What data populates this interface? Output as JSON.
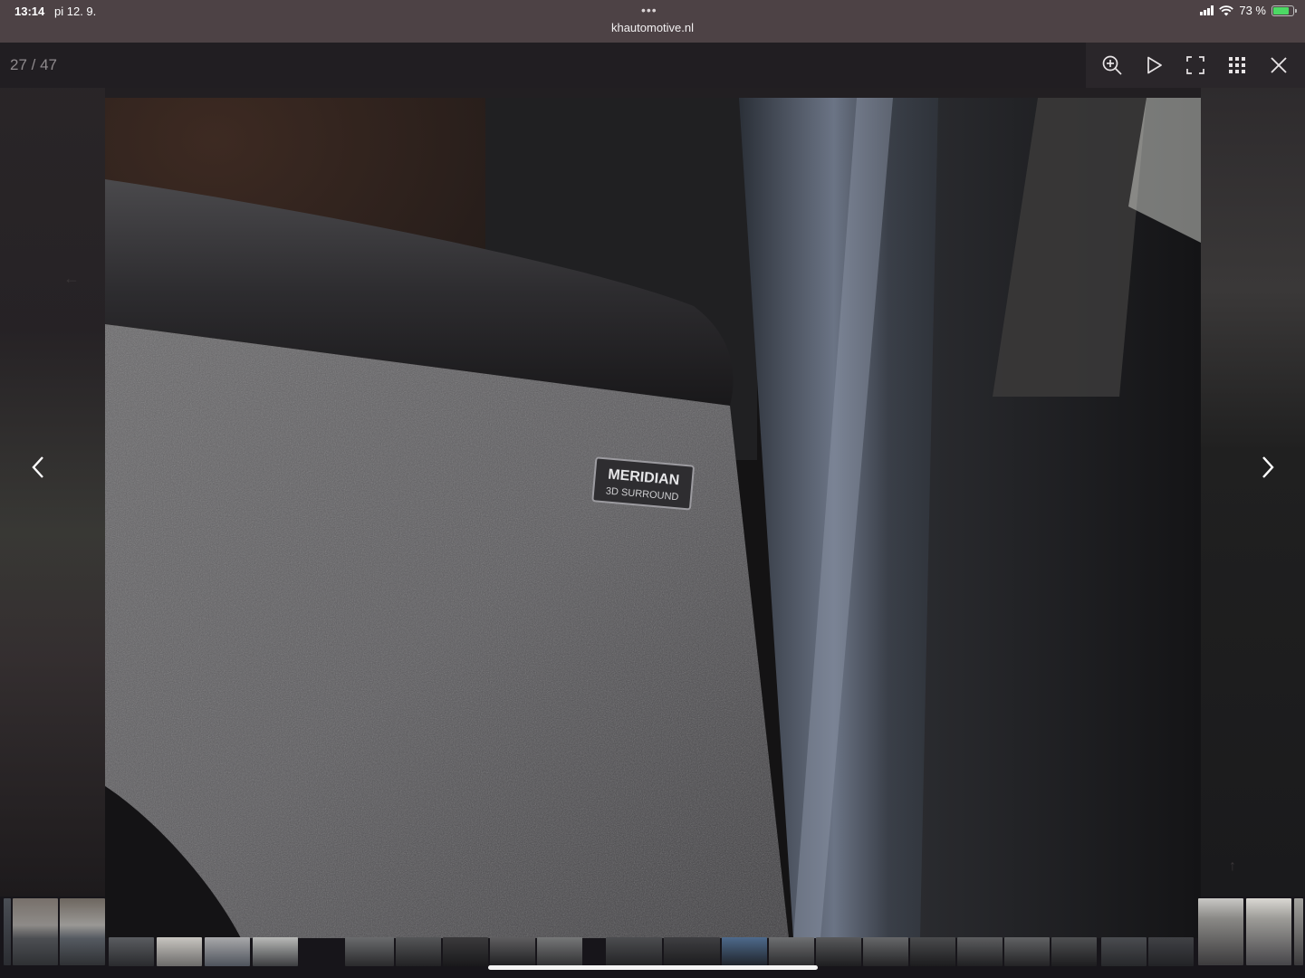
{
  "status": {
    "time": "13:14",
    "date": "pi 12. 9.",
    "url": "khautomotive.nl",
    "battery": "73 %",
    "battery_fraction": 0.73,
    "dots": "•••"
  },
  "gallery": {
    "counter": "27 / 47",
    "current_index": 27,
    "total": 47
  },
  "toolbar": {
    "icons": [
      "zoom-in-icon",
      "play-icon",
      "fullscreen-icon",
      "grid-icon",
      "close-icon"
    ]
  },
  "photo": {
    "badge_brand": "MERIDIAN",
    "badge_sub": "3D SURROUND"
  },
  "colors": {
    "status_bar": "#4d4245",
    "toolbar": "#211e22",
    "battery_fill": "#4cd964"
  }
}
